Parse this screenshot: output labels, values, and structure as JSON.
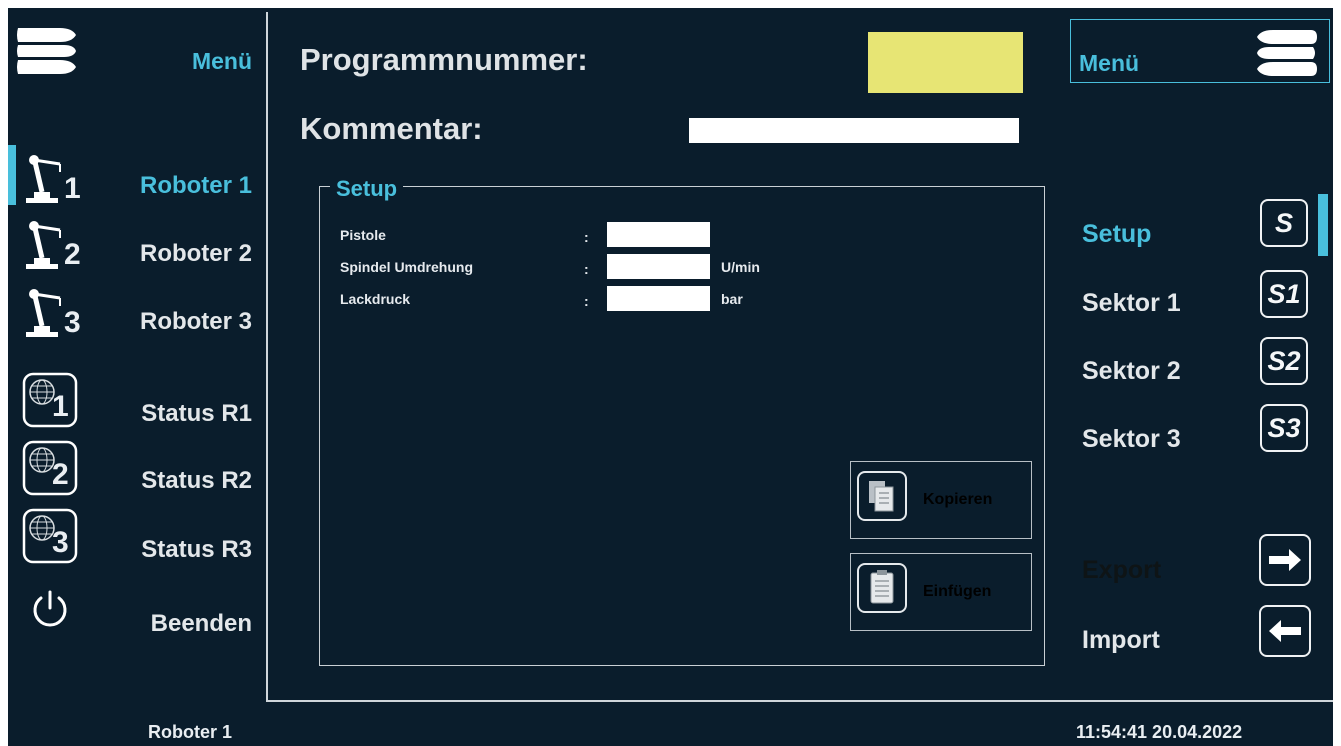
{
  "left_menu": {
    "menu_label": "Menü",
    "items": [
      {
        "label": "Roboter 1",
        "icon": "robot-arm-1-icon",
        "number": "1"
      },
      {
        "label": "Roboter 2",
        "icon": "robot-arm-2-icon",
        "number": "2"
      },
      {
        "label": "Roboter 3",
        "icon": "robot-arm-3-icon",
        "number": "3"
      },
      {
        "label": "Status R1",
        "icon": "globe-status-1-icon",
        "number": "1"
      },
      {
        "label": "Status R2",
        "icon": "globe-status-2-icon",
        "number": "2"
      },
      {
        "label": "Status R3",
        "icon": "globe-status-3-icon",
        "number": "3"
      },
      {
        "label": "Beenden",
        "icon": "power-icon"
      }
    ]
  },
  "header": {
    "program_label": "Programmnummer:",
    "program_value": "",
    "comment_label": "Kommentar:",
    "comment_value": ""
  },
  "setup": {
    "title": "Setup",
    "fields": [
      {
        "label": "Pistole",
        "colon": ":",
        "value": "",
        "unit": ""
      },
      {
        "label": "Spindel Umdrehung",
        "colon": ":",
        "value": "",
        "unit": "U/min"
      },
      {
        "label": "Lackdruck",
        "colon": ":",
        "value": "",
        "unit": "bar"
      }
    ],
    "copy_label": "Kopieren",
    "paste_label": "Einfügen"
  },
  "right_menu": {
    "menu_label": "Menü",
    "sections": [
      {
        "label": "Setup",
        "badge": "S"
      },
      {
        "label": "Sektor 1",
        "badge": "S1"
      },
      {
        "label": "Sektor 2",
        "badge": "S2"
      },
      {
        "label": "Sektor 3",
        "badge": "S3"
      }
    ],
    "export_label": "Export",
    "import_label": "Import"
  },
  "footer": {
    "robot": "Roboter 1",
    "datetime": "11:54:41 20.04.2022"
  },
  "colors": {
    "background": "#0a1d2c",
    "accent": "#49bfdc",
    "program_field": "#e7e574"
  }
}
